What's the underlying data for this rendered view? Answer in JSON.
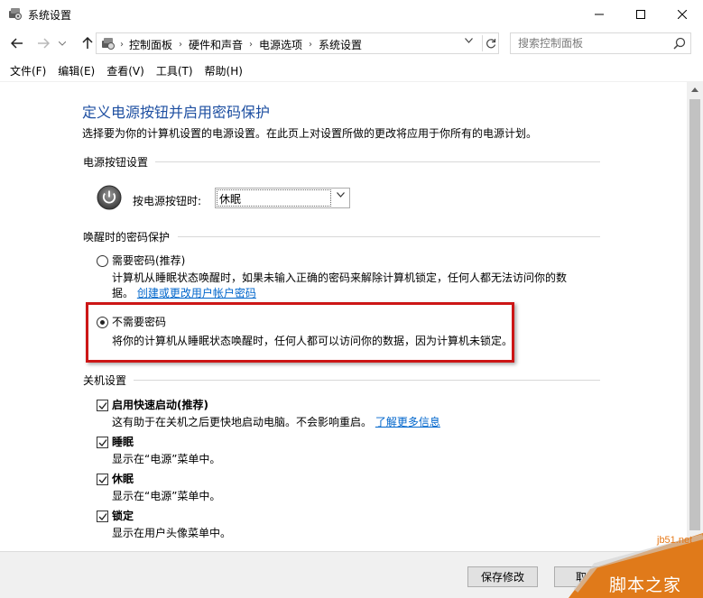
{
  "window": {
    "title": "系统设置",
    "controls": {
      "minimize": "minimize-icon",
      "maximize": "maximize-icon",
      "close": "close-icon"
    }
  },
  "address": {
    "crumbs": [
      "控制面板",
      "硬件和声音",
      "电源选项",
      "系统设置"
    ],
    "search_placeholder": "搜索控制面板"
  },
  "menu": [
    "文件(F)",
    "编辑(E)",
    "查看(V)",
    "工具(T)",
    "帮助(H)"
  ],
  "page": {
    "title": "定义电源按钮并启用密码保护",
    "description": "选择要为你的计算机设置的电源设置。在此页上对设置所做的更改将应用于你所有的电源计划。"
  },
  "power_buttons": {
    "group_title": "电源按钮设置",
    "label": "按电源按钮时:",
    "selected": "休眠"
  },
  "wake_password": {
    "group_title": "唤醒时的密码保护",
    "options": [
      {
        "label": "需要密码(推荐)",
        "desc_line1": "计算机从睡眠状态唤醒时，如果未输入正确的密码来解除计算机锁定，任何人都无法访问你的数",
        "desc_line2": "据。",
        "link": "创建或更改用户帐户密码",
        "selected": false
      },
      {
        "label": "不需要密码",
        "desc": "将你的计算机从睡眠状态唤醒时，任何人都可以访问你的数据，因为计算机未锁定。",
        "selected": true
      }
    ]
  },
  "shutdown": {
    "group_title": "关机设置",
    "items": [
      {
        "label": "启用快速启动(推荐)",
        "desc": "这有助于在关机之后更快地启动电脑。不会影响重启。",
        "link": "了解更多信息",
        "checked": true
      },
      {
        "label": "睡眠",
        "desc": "显示在“电源”菜单中。",
        "checked": true
      },
      {
        "label": "休眠",
        "desc": "显示在“电源”菜单中。",
        "checked": true
      },
      {
        "label": "锁定",
        "desc": "显示在用户头像菜单中。",
        "checked": true
      }
    ]
  },
  "buttons": {
    "save": "保存修改",
    "cancel": "取"
  },
  "watermark": {
    "url": "jb51.net",
    "text": "脚本之家"
  },
  "colors": {
    "title": "#1e4fa1",
    "link": "#0066cc",
    "highlight": "#cc1616",
    "watermark": "#e67817"
  }
}
